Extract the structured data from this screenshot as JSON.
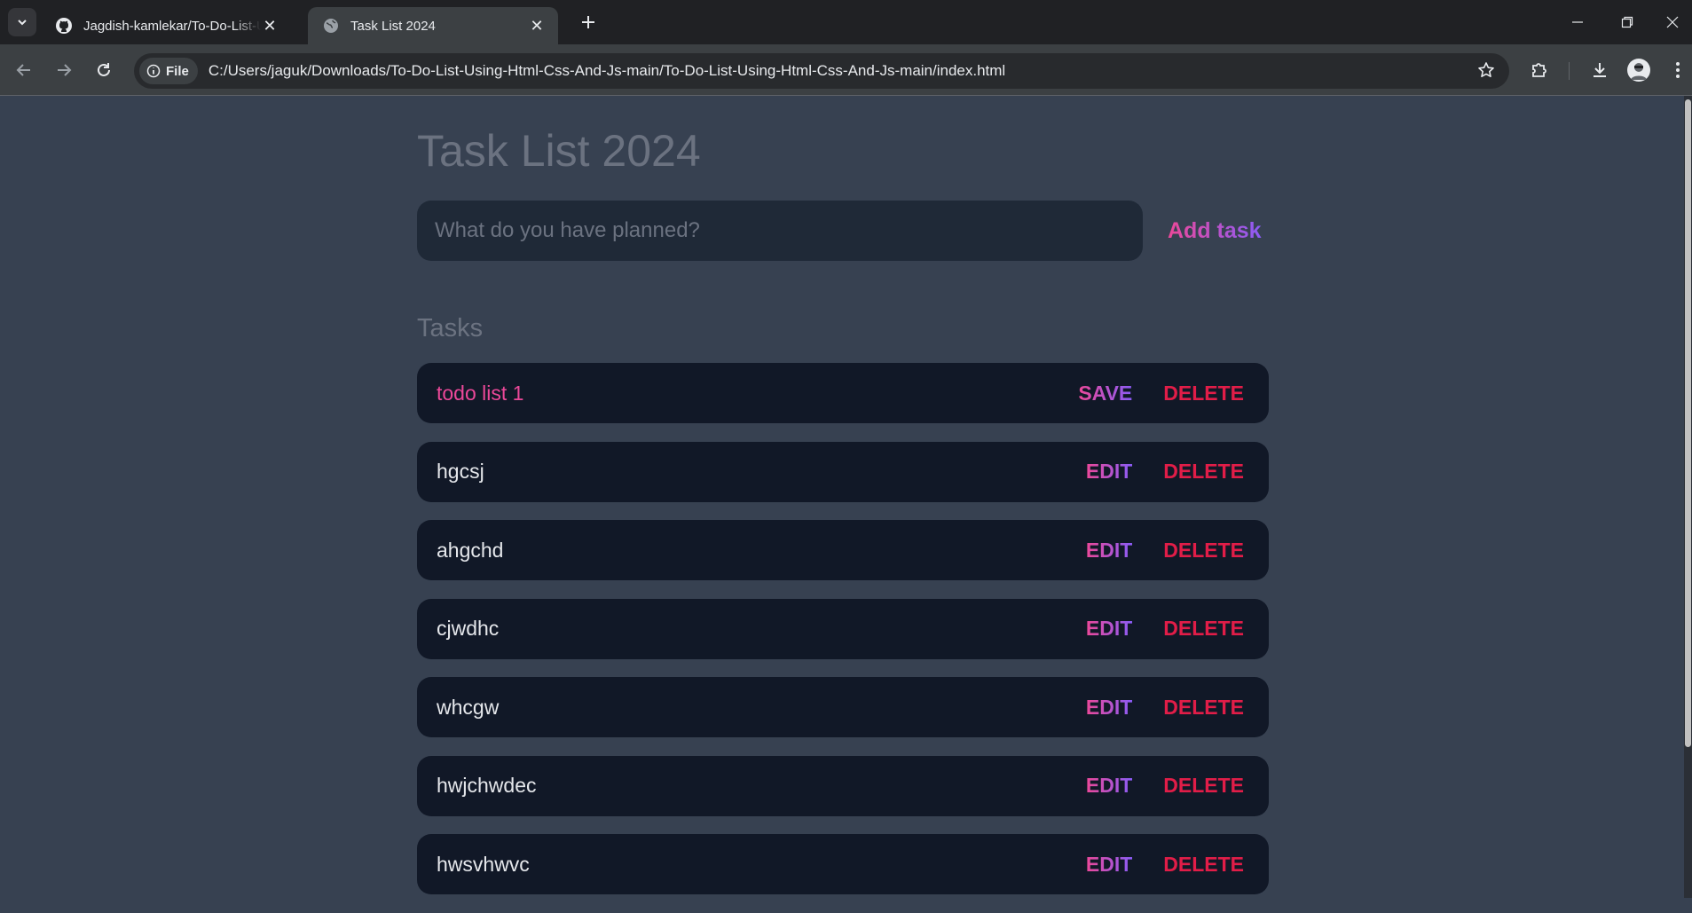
{
  "browser": {
    "tabs": [
      {
        "title": "Jagdish-kamlekar/To-Do-List-Using-Html-Css-And-Js",
        "active": false
      },
      {
        "title": "Task List 2024",
        "active": true
      }
    ],
    "url_chip": "File",
    "url": "C:/Users/jaguk/Downloads/To-Do-List-Using-Html-Css-And-Js-main/To-Do-List-Using-Html-Css-And-Js-main/index.html"
  },
  "app": {
    "title": "Task List 2024",
    "new_task_placeholder": "What do you have planned?",
    "add_button": "Add task",
    "tasks_heading": "Tasks",
    "edit_label": "EDIT",
    "save_label": "SAVE",
    "delete_label": "DELETE"
  },
  "tasks": [
    {
      "text": "todo list 1",
      "editing": true
    },
    {
      "text": "hgcsj",
      "editing": false
    },
    {
      "text": "ahgchd",
      "editing": false
    },
    {
      "text": "cjwdhc",
      "editing": false
    },
    {
      "text": "whcgw",
      "editing": false
    },
    {
      "text": "hwjchwdec",
      "editing": false
    },
    {
      "text": "hwsvhwvc",
      "editing": false
    }
  ],
  "colors": {
    "page_bg": "#374151",
    "task_bg": "#111827",
    "input_bg": "#1f2937",
    "accent_pink": "#ec4899",
    "accent_purple": "#8b5cf6",
    "delete_red": "#e11d48"
  }
}
